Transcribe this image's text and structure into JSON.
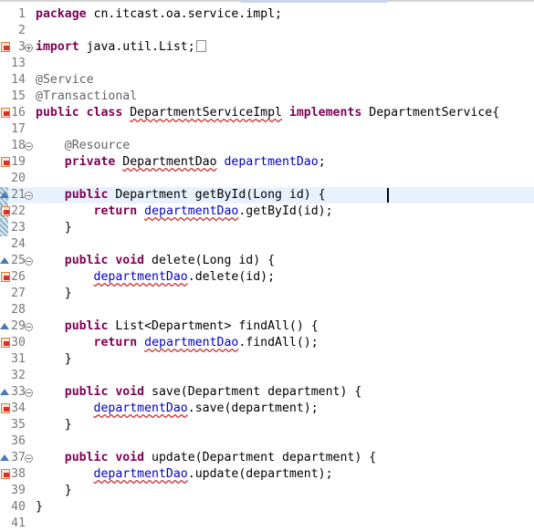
{
  "editor": {
    "lines": [
      {
        "num": "1",
        "tokens": [
          {
            "t": "kw",
            "s": "package"
          },
          {
            "t": "txt",
            "s": " cn.itcast.oa.service.impl;"
          }
        ]
      },
      {
        "num": "2",
        "tokens": []
      },
      {
        "num": "3",
        "fold": "plus",
        "marker": "error",
        "tokens": [
          {
            "t": "kw",
            "s": "import"
          },
          {
            "t": "txt",
            "s": " java.util.List;"
          }
        ],
        "folded": true
      },
      {
        "num": "13",
        "tokens": []
      },
      {
        "num": "14",
        "tokens": [
          {
            "t": "ann",
            "s": "@Service"
          }
        ]
      },
      {
        "num": "15",
        "tokens": [
          {
            "t": "ann",
            "s": "@Transactional"
          }
        ]
      },
      {
        "num": "16",
        "marker": "error",
        "tokens": [
          {
            "t": "kw",
            "s": "public class"
          },
          {
            "t": "txt",
            "s": " "
          },
          {
            "t": "squig",
            "s": "DepartmentServiceImpl"
          },
          {
            "t": "txt",
            "s": " "
          },
          {
            "t": "kw",
            "s": "implements"
          },
          {
            "t": "txt",
            "s": " DepartmentService{"
          }
        ]
      },
      {
        "num": "17",
        "tokens": []
      },
      {
        "num": "18",
        "fold": "minus",
        "tokens": [
          {
            "t": "txt",
            "s": "    "
          },
          {
            "t": "ann",
            "s": "@Resource"
          }
        ]
      },
      {
        "num": "19",
        "marker": "error",
        "tokens": [
          {
            "t": "txt",
            "s": "    "
          },
          {
            "t": "kw",
            "s": "private"
          },
          {
            "t": "txt",
            "s": " "
          },
          {
            "t": "squig",
            "s": "DepartmentDao"
          },
          {
            "t": "txt",
            "s": " "
          },
          {
            "t": "fld",
            "s": "departmentDao"
          },
          {
            "t": "txt",
            "s": ";"
          }
        ]
      },
      {
        "num": "20",
        "tokens": []
      },
      {
        "num": "21",
        "fold": "minus",
        "marker": "override",
        "current": true,
        "hatch": true,
        "tokens": [
          {
            "t": "txt",
            "s": "    "
          },
          {
            "t": "kw",
            "s": "public"
          },
          {
            "t": "txt",
            "s": " Department getById(Long id) {"
          }
        ]
      },
      {
        "num": "22",
        "marker": "error",
        "hatch": true,
        "tokens": [
          {
            "t": "txt",
            "s": "        "
          },
          {
            "t": "kw",
            "s": "return"
          },
          {
            "t": "txt",
            "s": " "
          },
          {
            "t": "fldsq",
            "s": "departmentDao"
          },
          {
            "t": "txt",
            "s": ".getById(id);"
          }
        ]
      },
      {
        "num": "23",
        "hatch": true,
        "tokens": [
          {
            "t": "txt",
            "s": "    }"
          }
        ]
      },
      {
        "num": "24",
        "tokens": []
      },
      {
        "num": "25",
        "fold": "minus",
        "marker": "override",
        "tokens": [
          {
            "t": "txt",
            "s": "    "
          },
          {
            "t": "kw",
            "s": "public void"
          },
          {
            "t": "txt",
            "s": " delete(Long id) {"
          }
        ]
      },
      {
        "num": "26",
        "marker": "error",
        "tokens": [
          {
            "t": "txt",
            "s": "        "
          },
          {
            "t": "fldsq",
            "s": "departmentDao"
          },
          {
            "t": "txt",
            "s": ".delete(id);"
          }
        ]
      },
      {
        "num": "27",
        "tokens": [
          {
            "t": "txt",
            "s": "    }"
          }
        ]
      },
      {
        "num": "28",
        "tokens": []
      },
      {
        "num": "29",
        "fold": "minus",
        "marker": "override",
        "tokens": [
          {
            "t": "txt",
            "s": "    "
          },
          {
            "t": "kw",
            "s": "public"
          },
          {
            "t": "txt",
            "s": " List<Department> findAll() {"
          }
        ]
      },
      {
        "num": "30",
        "marker": "error",
        "tokens": [
          {
            "t": "txt",
            "s": "        "
          },
          {
            "t": "kw",
            "s": "return"
          },
          {
            "t": "txt",
            "s": " "
          },
          {
            "t": "fldsq",
            "s": "departmentDao"
          },
          {
            "t": "txt",
            "s": ".findAll();"
          }
        ]
      },
      {
        "num": "31",
        "tokens": [
          {
            "t": "txt",
            "s": "    }"
          }
        ]
      },
      {
        "num": "32",
        "tokens": []
      },
      {
        "num": "33",
        "fold": "minus",
        "marker": "override",
        "tokens": [
          {
            "t": "txt",
            "s": "    "
          },
          {
            "t": "kw",
            "s": "public void"
          },
          {
            "t": "txt",
            "s": " save(Department department) {"
          }
        ]
      },
      {
        "num": "34",
        "marker": "error",
        "tokens": [
          {
            "t": "txt",
            "s": "        "
          },
          {
            "t": "fldsq",
            "s": "departmentDao"
          },
          {
            "t": "txt",
            "s": ".save(department);"
          }
        ]
      },
      {
        "num": "35",
        "tokens": [
          {
            "t": "txt",
            "s": "    }"
          }
        ]
      },
      {
        "num": "36",
        "tokens": []
      },
      {
        "num": "37",
        "fold": "minus",
        "marker": "override",
        "tokens": [
          {
            "t": "txt",
            "s": "    "
          },
          {
            "t": "kw",
            "s": "public void"
          },
          {
            "t": "txt",
            "s": " update(Department department) {"
          }
        ]
      },
      {
        "num": "38",
        "marker": "error",
        "tokens": [
          {
            "t": "txt",
            "s": "        "
          },
          {
            "t": "fldsq",
            "s": "departmentDao"
          },
          {
            "t": "txt",
            "s": ".update(department);"
          }
        ]
      },
      {
        "num": "39",
        "tokens": [
          {
            "t": "txt",
            "s": "    }"
          }
        ]
      },
      {
        "num": "40",
        "tokens": [
          {
            "t": "txt",
            "s": "}"
          }
        ]
      },
      {
        "num": "41",
        "tokens": []
      }
    ]
  },
  "colors": {
    "keyword": "#7f0055",
    "annotation": "#646464",
    "field": "#0000c0",
    "current_line": "#e8f2fe"
  }
}
